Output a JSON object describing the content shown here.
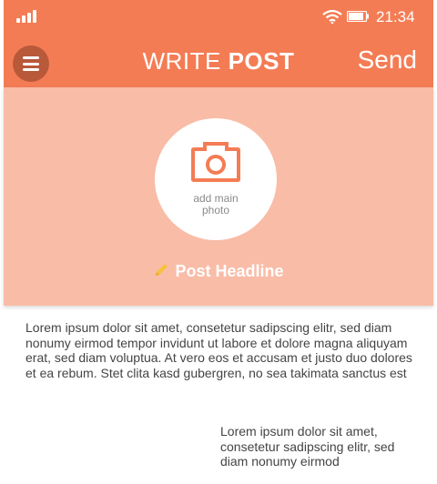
{
  "status": {
    "time": "21:34",
    "icons": [
      "signal-icon",
      "wifi-icon",
      "battery-icon"
    ]
  },
  "header": {
    "menu_icon": "hamburger-menu-icon",
    "title_light": "WRITE ",
    "title_bold": "POST",
    "send_label": "Send"
  },
  "hero": {
    "photo_icon": "camera-icon",
    "photo_label_line1": "add main",
    "photo_label_line2": "photo",
    "headline_icon": "pencil-icon",
    "headline": "Post Headline"
  },
  "content": {
    "paragraph": "Lorem ipsum dolor sit amet, consetetur sadipscing elitr, sed diam nonumy eirmod tempor invidunt ut labore et dolore magna aliquyam erat, sed diam voluptua. At vero eos et accusam et justo duo dolores et ea rebum. Stet clita kasd gubergren, no sea takimata sanctus est",
    "secondary": "Lorem ipsum dolor sit amet, consetetur sadipscing elitr, sed diam nonumy eirmod"
  },
  "colors": {
    "header": "#f47c54",
    "hero": "#f9bca7",
    "menu_button": "#b8593a",
    "pencil": "#f7c23a"
  }
}
